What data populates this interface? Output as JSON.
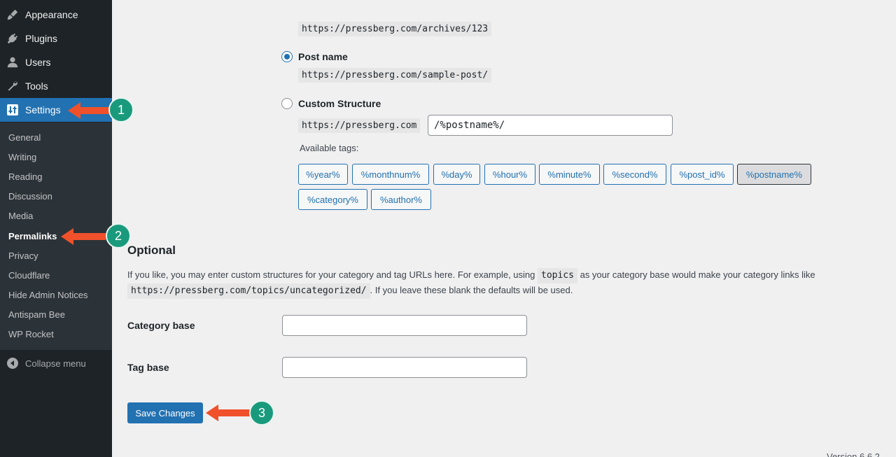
{
  "sidebar": {
    "menu": [
      {
        "label": "Appearance",
        "icon": "paintbrush-icon"
      },
      {
        "label": "Plugins",
        "icon": "plug-icon"
      },
      {
        "label": "Users",
        "icon": "user-icon"
      },
      {
        "label": "Tools",
        "icon": "wrench-icon"
      },
      {
        "label": "Settings",
        "icon": "settings-sliders-icon"
      }
    ],
    "submenu": [
      "General",
      "Writing",
      "Reading",
      "Discussion",
      "Media",
      "Permalinks",
      "Privacy",
      "Cloudflare",
      "Hide Admin Notices",
      "Antispam Bee",
      "WP Rocket"
    ],
    "collapse_label": "Collapse menu"
  },
  "permalinks": {
    "numeric_example": "https://pressberg.com/archives/123",
    "post_name": {
      "label": "Post name",
      "example": "https://pressberg.com/sample-post/",
      "checked": true
    },
    "custom": {
      "label": "Custom Structure",
      "prefix": "https://pressberg.com",
      "value": "/%postname%/",
      "checked": false
    },
    "available_tags_label": "Available tags:",
    "tags": [
      "%year%",
      "%monthnum%",
      "%day%",
      "%hour%",
      "%minute%",
      "%second%",
      "%post_id%",
      "%postname%",
      "%category%",
      "%author%"
    ]
  },
  "optional": {
    "title": "Optional",
    "desc_part1": "If you like, you may enter custom structures for your category and tag URLs here. For example, using",
    "desc_code1": "topics",
    "desc_part2": "as your category base would make your category links like",
    "desc_code2": "https://pressberg.com/topics/uncategorized/",
    "desc_part3": ". If you leave these blank the defaults will be used.",
    "category_base_label": "Category base",
    "tag_base_label": "Tag base",
    "category_base_value": "",
    "tag_base_value": ""
  },
  "save_button": "Save Changes",
  "footer_version": "Version 6.6.2",
  "annotations": {
    "step1": "1",
    "step2": "2",
    "step3": "3",
    "arrow_color": "#f0512b",
    "badge_color": "#1a9a7c"
  },
  "colors": {
    "sidebar": "#1d2327",
    "submenu": "#2c3338",
    "accent": "#2271b1",
    "background": "#f0f0f1"
  }
}
